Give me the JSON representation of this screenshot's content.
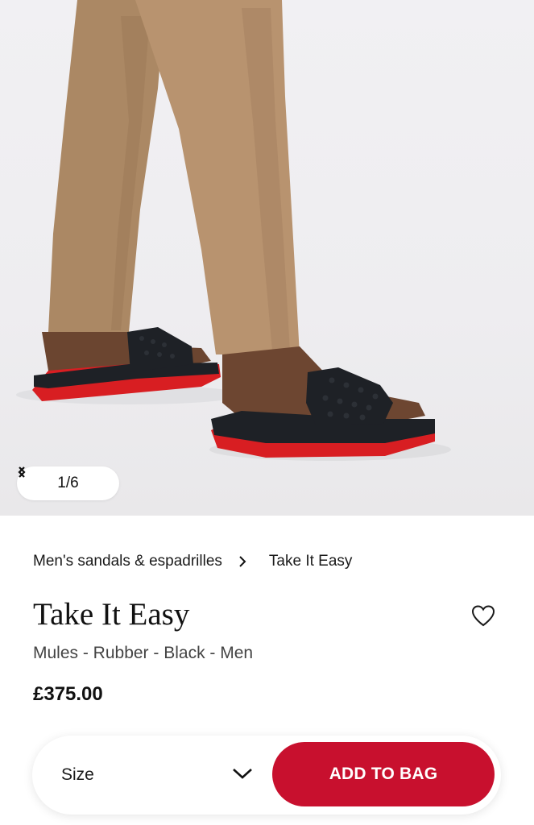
{
  "gallery": {
    "counter": "1/6",
    "prev_icon": "chevron-left-icon",
    "next_icon": "chevron-right-icon"
  },
  "breadcrumb": {
    "parent": "Men's sandals & espadrilles",
    "current": "Take It Easy",
    "separator_icon": "chevron-right-icon"
  },
  "product": {
    "name": "Take It Easy",
    "description": "Mules - Rubber - Black - Men",
    "price": "£375.00",
    "wishlist_icon": "heart-outline-icon"
  },
  "buy_bar": {
    "size_label": "Size",
    "size_icon": "chevron-down-icon",
    "add_to_bag_label": "ADD TO BAG"
  },
  "colors": {
    "accent": "#c8102e",
    "sole_red": "#d81e22",
    "sandal_black": "#1e2126",
    "trousers": "#b08d6b"
  }
}
